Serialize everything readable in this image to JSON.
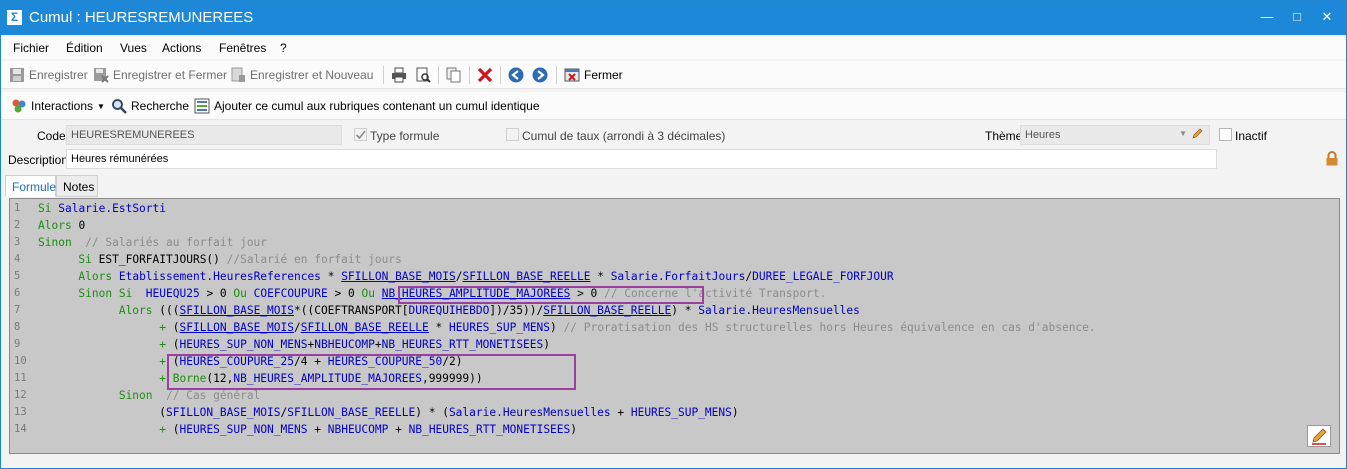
{
  "window": {
    "title": "Cumul : HEURESREMUNEREES",
    "buttons": [
      "—",
      "□",
      "✕"
    ]
  },
  "menu": [
    "Fichier",
    "Édition",
    "Vues",
    "Actions",
    "Fenêtres",
    "?"
  ],
  "toolbar": {
    "save": "Enregistrer",
    "save_close": "Enregistrer et Fermer",
    "save_new": "Enregistrer et Nouveau",
    "close": "Fermer"
  },
  "toolbar2": {
    "interactions": "Interactions",
    "search": "Recherche",
    "add_cumul": "Ajouter ce cumul aux rubriques contenant un cumul identique"
  },
  "form": {
    "code_label": "Code",
    "code_value": "HEURESREMUNEREES",
    "type_formule": "Type formule",
    "cumul_taux": "Cumul de taux (arrondi à 3 décimales)",
    "theme_label": "Thème",
    "theme_value": "Heures",
    "inactif": "Inactif",
    "description_label": "Description",
    "description_value": "Heures rémunérées"
  },
  "tabs": [
    "Formule",
    "Notes"
  ],
  "editor": {
    "line_numbers": [
      "1",
      "2",
      "3",
      "4",
      "5",
      "6",
      "7",
      "8",
      "9",
      "10",
      "11",
      "12",
      "13",
      "14"
    ]
  },
  "colors": {
    "titlebar": "#1e88d8",
    "keyword": "#1c8d12",
    "identifier": "#0000c8",
    "comment": "#8c8c8c",
    "highlight_box": "#9a3ea0"
  }
}
